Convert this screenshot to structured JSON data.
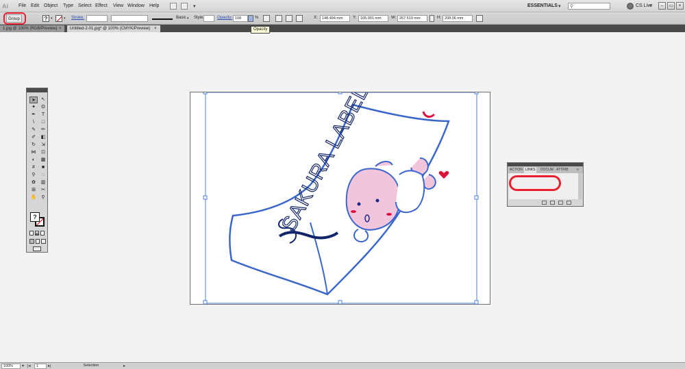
{
  "app": {
    "logo": "Ai"
  },
  "menu": {
    "items": [
      "File",
      "Edit",
      "Object",
      "Type",
      "Select",
      "Effect",
      "View",
      "Window",
      "Help"
    ],
    "workspace": "ESSENTIALS",
    "cs_live": "CS Live"
  },
  "control": {
    "selection_type": "Group",
    "fill_glyph": "?",
    "stroke_label": "Stroke:",
    "brush_label": "Basic",
    "style_label": "Style:",
    "opacity_label": "Opacity:",
    "opacity_value": "100",
    "opacity_unit": "%",
    "x_label": "X:",
    "x_value": "148.494 mm",
    "y_label": "Y:",
    "y_value": "105.001 mm",
    "w_label": "W:",
    "w_value": "267.519 mm",
    "h_label": "H:",
    "h_value": "208.06 mm",
    "tooltip": "Opacity"
  },
  "tabs": [
    {
      "label": "1.jpg @ 100% (RGB/Preview)",
      "active": false
    },
    {
      "label": "Untitled-2-01.jpg* @ 100% (CMYK/Preview)",
      "active": true
    }
  ],
  "tools": {
    "icons": [
      "selection-tool",
      "direct-selection-tool",
      "magic-wand-tool",
      "lasso-tool",
      "pen-tool",
      "type-tool",
      "line-segment-tool",
      "rectangle-tool",
      "paintbrush-tool",
      "pencil-tool",
      "blob-brush-tool",
      "eraser-tool",
      "rotate-tool",
      "scale-tool",
      "width-tool",
      "free-transform-tool",
      "shape-builder-tool",
      "perspective-grid-tool",
      "mesh-tool",
      "gradient-tool",
      "eyedropper-tool",
      "blend-tool",
      "symbol-sprayer-tool",
      "column-graph-tool",
      "artboard-tool",
      "slice-tool",
      "hand-tool",
      "zoom-tool"
    ],
    "glyphs": [
      "➤",
      "↖",
      "✦",
      "ʘ",
      "✒",
      "T",
      "\\",
      "□",
      "✎",
      "✏",
      "✐",
      "◧",
      "↻",
      "⇲",
      "⋈",
      "⊡",
      "◐",
      "▦",
      "#",
      "■",
      "⚲",
      "◌",
      "✿",
      "▥",
      "⊞",
      "✂",
      "✋",
      "⚲"
    ],
    "fill_glyph": "?"
  },
  "artwork": {
    "text": "SAKURA LABEL",
    "colors": {
      "outline": "#3a66cc",
      "outline_dark": "#12246a",
      "body_fill": "#f1c5dc",
      "accent": "#e0103c",
      "eyes": "#1a2a88"
    }
  },
  "links_panel": {
    "tabs": [
      "ACTION",
      "LINKS",
      "DOCUM",
      "ATTRIB"
    ],
    "active_tab": "LINKS"
  },
  "status": {
    "zoom": "100%",
    "artboard": "1",
    "tool_name": "Selection"
  },
  "annotation_color": "#e8202e"
}
